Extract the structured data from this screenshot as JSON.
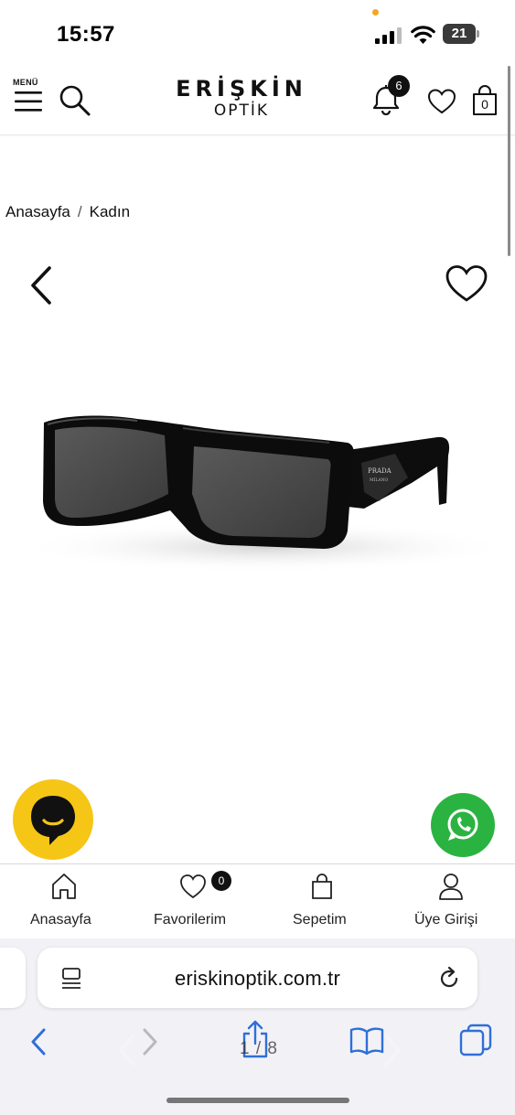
{
  "status_bar": {
    "time": "15:57",
    "battery": "21",
    "icons": [
      "signal-icon",
      "wifi-icon",
      "battery-icon"
    ]
  },
  "header": {
    "menu_label": "MENÜ",
    "logo_main": "ERİŞKİN",
    "logo_sub": "OPTİK",
    "notification_count": "6",
    "cart_count": "0",
    "icons": [
      "menu-icon",
      "search-icon",
      "bell-icon",
      "heart-icon",
      "bag-icon"
    ]
  },
  "breadcrumb": {
    "items": [
      "Anasayfa",
      "Kadın"
    ],
    "separator": "/"
  },
  "product": {
    "image_subject": "black sunglasses",
    "temple_text": [
      "PRADA",
      "MILANO"
    ]
  },
  "bottom_nav": {
    "items": [
      {
        "label": "Anasayfa",
        "icon": "home-icon"
      },
      {
        "label": "Favorilerim",
        "icon": "heart-icon",
        "badge": "0"
      },
      {
        "label": "Sepetim",
        "icon": "bag-icon"
      },
      {
        "label": "Üye Girişi",
        "icon": "user-icon"
      }
    ]
  },
  "browser": {
    "url": "eriskinoptik.com.tr",
    "page_counter": "1 / 8",
    "icons": [
      "page-menu-icon",
      "reload-icon",
      "back-icon",
      "forward-icon",
      "share-icon",
      "bookmarks-icon",
      "tabs-icon"
    ]
  },
  "colors": {
    "chat_button": "#f6c616",
    "whatsapp_button": "#2bb342",
    "browser_accent": "#2f6fd8",
    "status_dot": "#f5a623"
  }
}
